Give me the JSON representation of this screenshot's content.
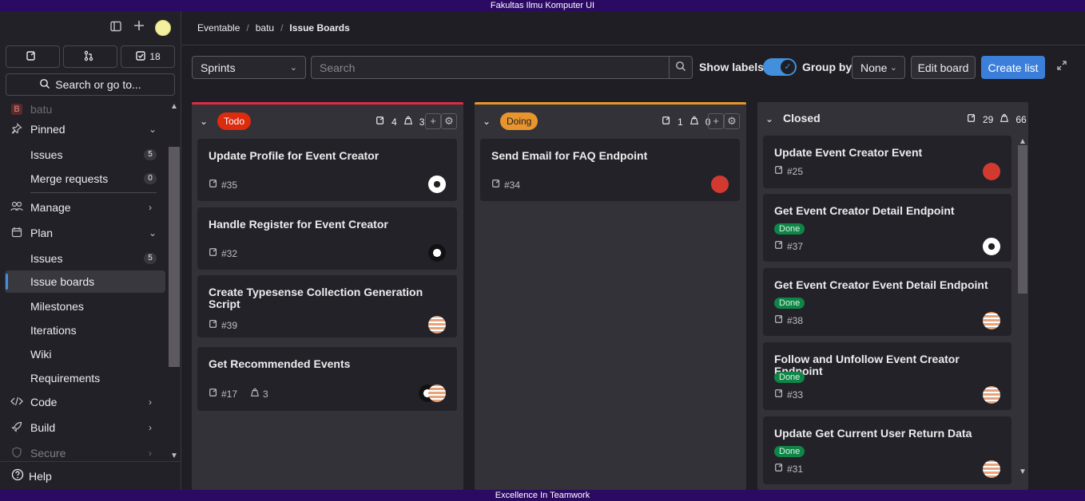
{
  "topbar": {
    "title": "Fakultas Ilmu Komputer UI"
  },
  "bottombar": {
    "title": "Excellence In Teamwork"
  },
  "sidebar": {
    "counters": {
      "issues": "",
      "merge_requests": "",
      "todos": "18"
    },
    "search_label": "Search or go to...",
    "project_partial": "batu",
    "project_initial": "B",
    "items": [
      {
        "label": "Pinned",
        "icon": "pin-icon"
      },
      {
        "label": "Issues",
        "badge": "5"
      },
      {
        "label": "Merge requests",
        "badge": "0"
      },
      {
        "label": "Manage",
        "icon": "users-icon"
      },
      {
        "label": "Plan",
        "icon": "calendar-icon"
      },
      {
        "label": "Issues",
        "badge": "5"
      },
      {
        "label": "Issue boards"
      },
      {
        "label": "Milestones"
      },
      {
        "label": "Iterations"
      },
      {
        "label": "Wiki"
      },
      {
        "label": "Requirements"
      },
      {
        "label": "Code",
        "icon": "code-icon"
      },
      {
        "label": "Build",
        "icon": "rocket-icon"
      },
      {
        "label": "Secure",
        "icon": "shield-icon"
      }
    ],
    "help_label": "Help"
  },
  "breadcrumb": [
    "Eventable",
    "batu",
    "Issue Boards"
  ],
  "toolbar": {
    "board_select": "Sprints",
    "search_placeholder": "Search",
    "show_labels": "Show labels",
    "group_by": "Group by",
    "group_value": "None",
    "edit_board": "Edit board",
    "create_list": "Create list"
  },
  "colors": {
    "todo": "#dd2b0e",
    "doing": "#e9952e",
    "accent": "#428fdc",
    "done": "#108548"
  },
  "lists": {
    "todo": {
      "label": "Todo",
      "issues": "4",
      "weight": "3",
      "cards": [
        {
          "title": "Update Profile for Event Creator",
          "id": "#35"
        },
        {
          "title": "Handle Register for Event Creator",
          "id": "#32"
        },
        {
          "title": "Create Typesense Collection Generation Script",
          "id": "#39"
        },
        {
          "title": "Get Recommended Events",
          "id": "#17",
          "weight": "3"
        }
      ]
    },
    "doing": {
      "label": "Doing",
      "issues": "1",
      "weight": "0",
      "cards": [
        {
          "title": "Send Email for FAQ Endpoint",
          "id": "#34"
        }
      ]
    },
    "closed": {
      "label": "Closed",
      "issues": "29",
      "weight": "66",
      "cards": [
        {
          "title": "Update Event Creator Event",
          "id": "#25"
        },
        {
          "title": "Get Event Creator Detail Endpoint",
          "id": "#37",
          "label": "Done"
        },
        {
          "title": "Get Event Creator Event Detail Endpoint",
          "id": "#38",
          "label": "Done"
        },
        {
          "title": "Follow and Unfollow Event Creator Endpoint",
          "id": "#33",
          "label": "Done"
        },
        {
          "title": "Update Get Current User Return Data",
          "id": "#31",
          "label": "Done"
        }
      ]
    }
  }
}
